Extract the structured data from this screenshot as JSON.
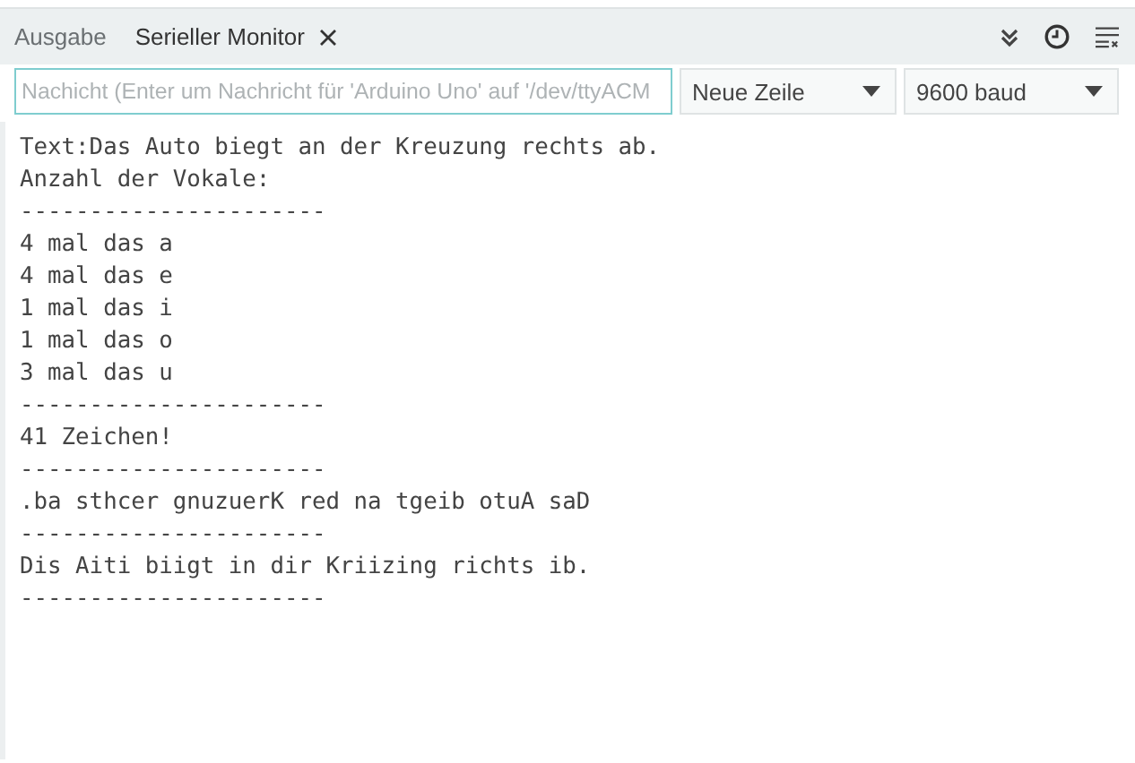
{
  "tabs": [
    {
      "label": "Ausgabe",
      "selected": false,
      "closable": false
    },
    {
      "label": "Serieller Monitor",
      "selected": true,
      "closable": true
    }
  ],
  "toolbar": {
    "icons": [
      {
        "kind": "autoscroll"
      },
      {
        "kind": "timestamp"
      },
      {
        "kind": "clear"
      }
    ]
  },
  "message_field": {
    "placeholder": "Nachicht (Enter um Nachricht für 'Arduino Uno' auf '/dev/ttyACM"
  },
  "line_ending": {
    "value": "Neue Zeile"
  },
  "baud_rate": {
    "value": "9600 baud"
  },
  "output_lines": [
    "Text:Das Auto biegt an der Kreuzung rechts ab.",
    "Anzahl der Vokale:",
    "----------------------",
    "4 mal das a",
    "4 mal das e",
    "1 mal das i",
    "1 mal das o",
    "3 mal das u",
    "----------------------",
    "41 Zeichen!",
    "----------------------",
    ".ba sthcer gnuzuerK red na tgeib otuA saD",
    "----------------------",
    "Dis Aiti biigt in dir Kriizing richts ib.",
    "----------------------"
  ]
}
